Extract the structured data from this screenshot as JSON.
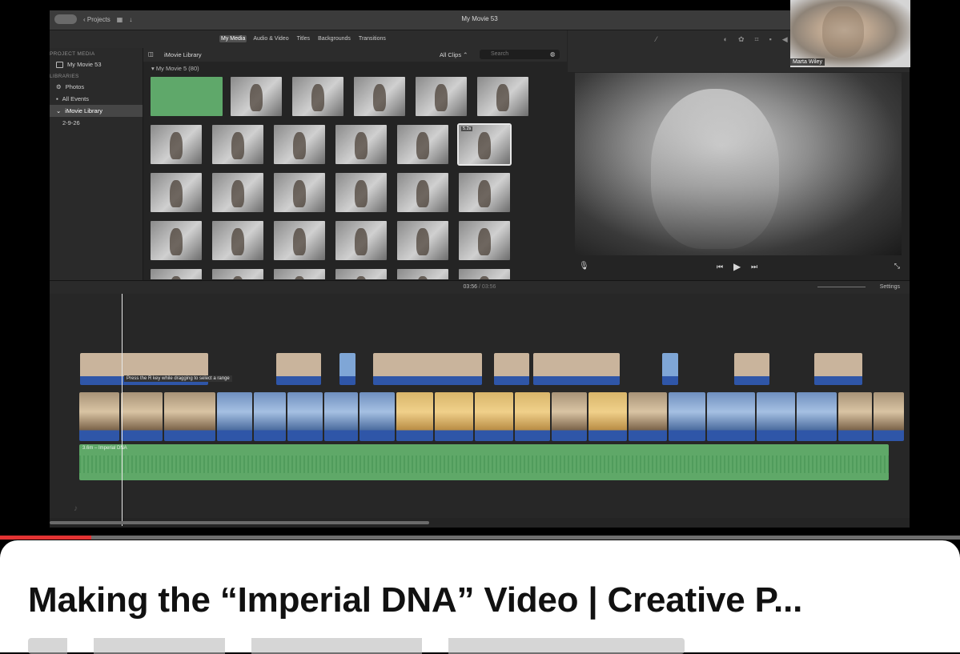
{
  "app": {
    "window_title": "My Movie 53",
    "projects_label": "Projects"
  },
  "browser_tabs": [
    {
      "label": "My Media",
      "active": true
    },
    {
      "label": "Audio & Video",
      "active": false
    },
    {
      "label": "Titles",
      "active": false
    },
    {
      "label": "Backgrounds",
      "active": false
    },
    {
      "label": "Transitions",
      "active": false
    }
  ],
  "sidebar": {
    "project_media_header": "PROJECT MEDIA",
    "project_item": "My Movie 53",
    "libraries_header": "LIBRARIES",
    "items": [
      {
        "label": "Photos",
        "icon": "gear-icon"
      },
      {
        "label": "All Events",
        "icon": "star-icon"
      },
      {
        "label": "iMovie Library",
        "icon": "chevron-down-icon",
        "selected": true
      },
      {
        "label": "2-9-26",
        "icon": ""
      }
    ]
  },
  "browser": {
    "library_label": "iMovie Library",
    "filter_label": "All Clips",
    "search_placeholder": "Search",
    "event_label": "My Movie 5",
    "event_count": "(80)",
    "selected_clip_duration": "5.2s"
  },
  "viewer": {
    "icons": [
      "magic-wand-icon",
      "color-balance-icon",
      "color-correction-icon",
      "crop-icon",
      "stabilization-icon",
      "volume-icon",
      "equalizer-icon",
      "speed-icon",
      "noise-reduction-icon",
      "info-icon"
    ]
  },
  "timeline": {
    "current_time": "03:56",
    "separator": "/",
    "total_time": "03:56",
    "settings_label": "Settings",
    "tooltip": "Press the R key while dragging to select a range",
    "audio_label": "3.6m – Imperial DNA"
  },
  "webcam": {
    "name": "Marta Wiley"
  },
  "video": {
    "title": "Making the “Imperial DNA” Video | Creative P...",
    "progress": 0.095,
    "accent": "#e33333"
  }
}
